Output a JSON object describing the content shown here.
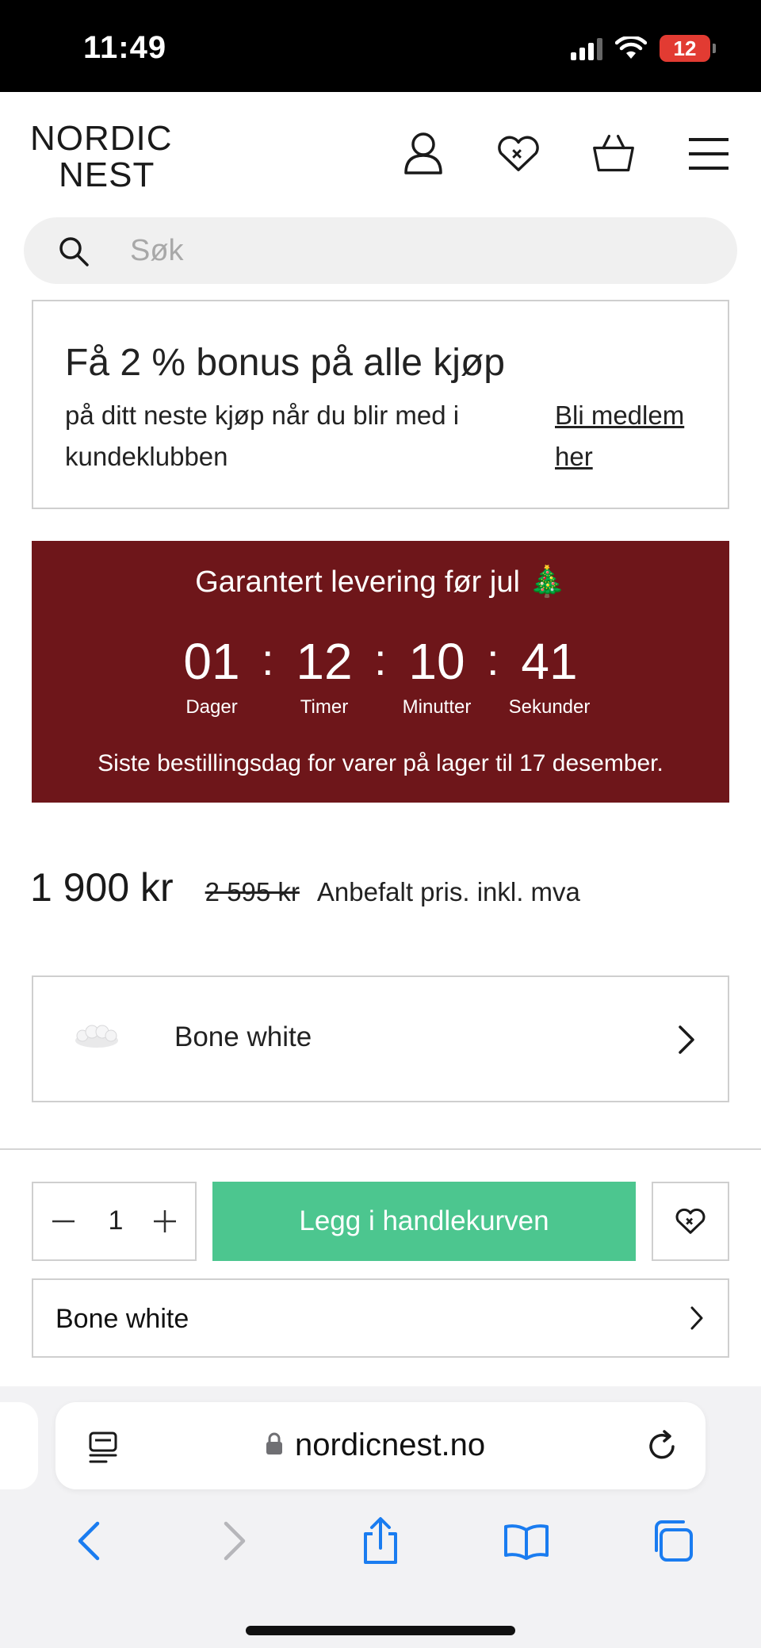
{
  "status_bar": {
    "time": "11:49",
    "battery": "12"
  },
  "header": {
    "logo_line1": "NORDIC",
    "logo_line2": "NEST",
    "icons": [
      "account-icon",
      "wishlist-heart-icon",
      "basket-icon",
      "menu-icon"
    ]
  },
  "search": {
    "placeholder": "Søk"
  },
  "bonus": {
    "title": "Få 2 % bonus på alle kjøp",
    "text": "på ditt neste kjøp når du blir med i kundeklubben",
    "link": "Bli medlem her"
  },
  "xmas": {
    "title": "Garantert levering før jul 🎄",
    "countdown": [
      {
        "value": "01",
        "label": "Dager"
      },
      {
        "value": "12",
        "label": "Timer"
      },
      {
        "value": "10",
        "label": "Minutter"
      },
      {
        "value": "41",
        "label": "Sekunder"
      }
    ],
    "separator": ":",
    "note": "Siste bestillingsdag for varer på lager til 17 desember.",
    "color": "#6e161a"
  },
  "price": {
    "current": "1 900 kr",
    "original": "2 595 kr",
    "note": "Anbefalt pris. inkl. mva"
  },
  "variant": {
    "label": "Bone white"
  },
  "purchase": {
    "quantity": "1",
    "add_to_cart": "Legg i handlekurven",
    "button_color": "#4cc68f",
    "variant_label": "Bone white"
  },
  "browser": {
    "url": "nordicnest.no",
    "accent_color": "#1a7cf0"
  }
}
